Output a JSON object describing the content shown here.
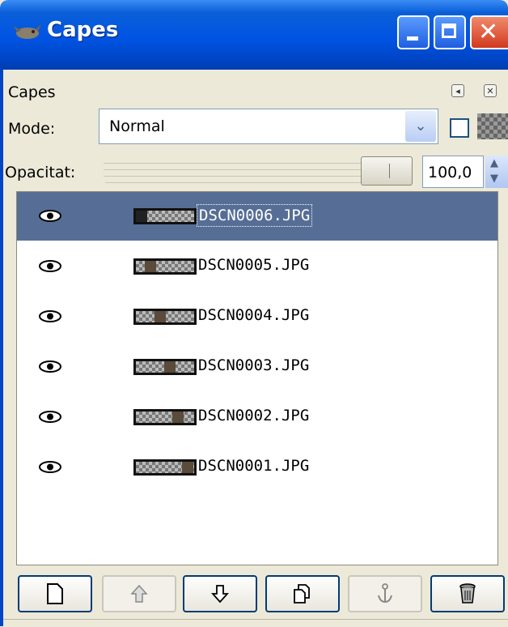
{
  "window": {
    "title": "Capes",
    "controls": [
      "minimize",
      "maximize",
      "close"
    ]
  },
  "dock": {
    "title": "Capes",
    "menu_icon": "tab-menu-icon",
    "close_icon": "close-tab-icon"
  },
  "mode": {
    "label": "Mode:",
    "value": "Normal"
  },
  "opacity": {
    "label": "Opacitat:",
    "value": "100,0",
    "level": 1.0
  },
  "layers": [
    {
      "name": "DSCN0006.JPG",
      "visible": true,
      "selected": true
    },
    {
      "name": "DSCN0005.JPG",
      "visible": true,
      "selected": false
    },
    {
      "name": "DSCN0004.JPG",
      "visible": true,
      "selected": false
    },
    {
      "name": "DSCN0003.JPG",
      "visible": true,
      "selected": false
    },
    {
      "name": "DSCN0002.JPG",
      "visible": true,
      "selected": false
    },
    {
      "name": "DSCN0001.JPG",
      "visible": true,
      "selected": false
    }
  ],
  "toolbar": [
    {
      "icon": "new-layer-icon",
      "enabled": true
    },
    {
      "icon": "raise-layer-icon",
      "enabled": false
    },
    {
      "icon": "lower-layer-icon",
      "enabled": true
    },
    {
      "icon": "duplicate-layer-icon",
      "enabled": true
    },
    {
      "icon": "anchor-layer-icon",
      "enabled": false
    },
    {
      "icon": "delete-layer-icon",
      "enabled": true
    }
  ],
  "colors": {
    "titlebar": "#0054e3",
    "selection": "#566e96",
    "close_button": "#d2391e"
  }
}
